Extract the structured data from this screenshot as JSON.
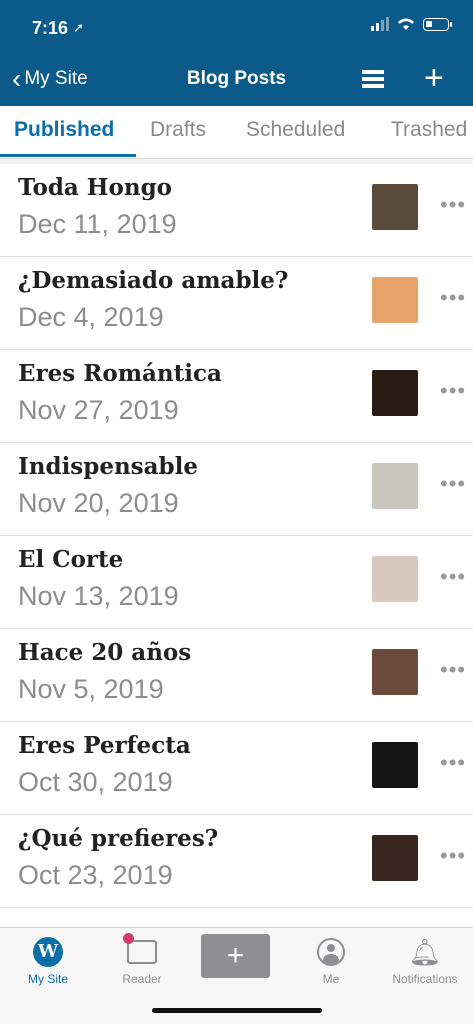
{
  "status": {
    "time": "7:16",
    "location_glyph": "➚"
  },
  "nav": {
    "back_label": "My Site",
    "title": "Blog Posts"
  },
  "tabs": [
    {
      "label": "Published",
      "active": true
    },
    {
      "label": "Drafts"
    },
    {
      "label": "Scheduled"
    },
    {
      "label": "Trashed"
    }
  ],
  "posts": [
    {
      "title": "Toda Hongo",
      "date": "Dec 11, 2019",
      "thumb": "#5b4b3a"
    },
    {
      "title": "¿Demasiado amable?",
      "date": "Dec 4, 2019",
      "thumb": "#e6a36a"
    },
    {
      "title": "Eres Romántica",
      "date": "Nov 27, 2019",
      "thumb": "#2a1a14"
    },
    {
      "title": "Indispensable",
      "date": "Nov 20, 2019",
      "thumb": "#c9c6bd"
    },
    {
      "title": "El Corte",
      "date": "Nov 13, 2019",
      "thumb": "#d8c8c0"
    },
    {
      "title": "Hace 20 años",
      "date": "Nov 5, 2019",
      "thumb": "#6b4a3c"
    },
    {
      "title": "Eres Perfecta",
      "date": "Oct 30, 2019",
      "thumb": "#141414"
    },
    {
      "title": "¿Qué prefieres?",
      "date": "Oct 23, 2019",
      "thumb": "#3a2620"
    }
  ],
  "more_glyph": "•••",
  "tabbar": {
    "my_site": "My Site",
    "reader": "Reader",
    "compose_glyph": "+",
    "me": "Me",
    "notifications": "Notifications"
  },
  "colors": {
    "header": "#0c5a8a",
    "accent": "#0c6ea8",
    "reader_dot": "#d63c6a"
  }
}
